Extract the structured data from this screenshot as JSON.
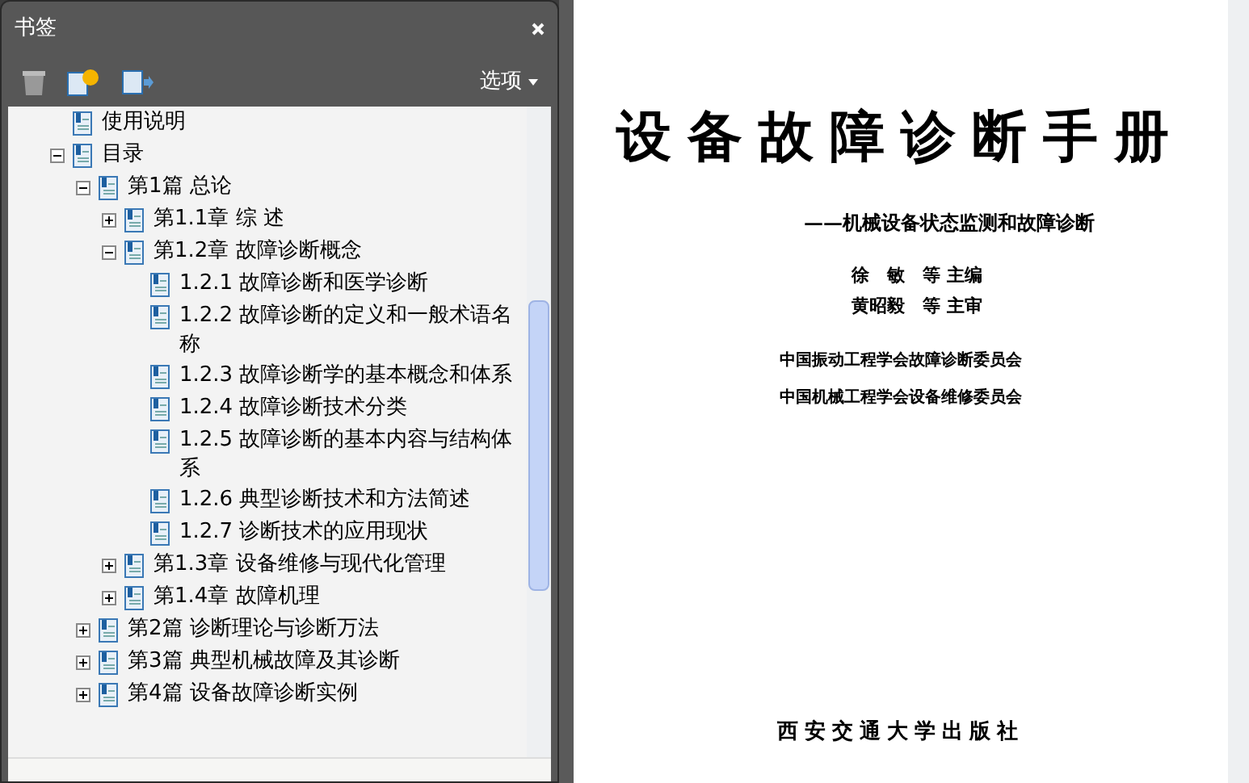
{
  "panel": {
    "title": "书签",
    "options": "选项"
  },
  "tree": [
    {
      "label": "使用说明"
    },
    {
      "label": "目录",
      "expanded": true,
      "children": [
        {
          "label": "第1篇 总论",
          "expanded": true,
          "children": [
            {
              "label": "第1.1章 综 述",
              "expanded": false
            },
            {
              "label": "第1.2章 故障诊断概念",
              "expanded": true,
              "children": [
                {
                  "label": "1.2.1 故障诊断和医学诊断"
                },
                {
                  "label": "1.2.2 故障诊断的定义和一般术语名称"
                },
                {
                  "label": "1.2.3 故障诊断学的基本概念和体系"
                },
                {
                  "label": "1.2.4 故障诊断技术分类"
                },
                {
                  "label": "1.2.5 故障诊断的基本内容与结构体系"
                },
                {
                  "label": "1.2.6 典型诊断技术和方法简述"
                },
                {
                  "label": "1.2.7 诊断技术的应用现状"
                }
              ]
            },
            {
              "label": "第1.3章 设备维修与现代化管理",
              "expanded": false
            },
            {
              "label": "第1.4章 故障机理",
              "expanded": false
            }
          ]
        },
        {
          "label": "第2篇 诊断理论与诊断万法",
          "expanded": false
        },
        {
          "label": "第3篇 典型机械故障及其诊断",
          "expanded": false
        },
        {
          "label": "第4篇 设备故障诊断实例",
          "expanded": false
        }
      ]
    }
  ],
  "page": {
    "title": "设备故障诊断手册",
    "subtitle": "——机械设备状态监测和故障诊断",
    "credits": [
      "徐　敏　等 主编",
      "黄昭毅　等 主审"
    ],
    "committees": [
      "中国振动工程学会故障诊断委员会",
      "中国机械工程学会设备维修委员会"
    ],
    "publisher": "西安交通大学出版社"
  }
}
